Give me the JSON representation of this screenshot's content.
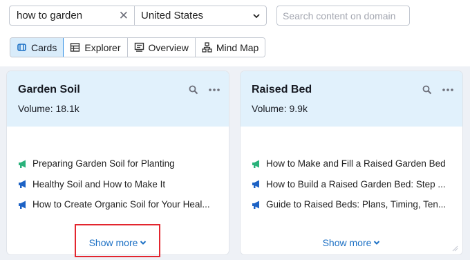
{
  "search": {
    "keyword": "how to garden",
    "clear_icon": "close-icon",
    "country": "United States",
    "domain_placeholder": "Search content on domain"
  },
  "tabs": [
    {
      "label": "Cards",
      "icon": "cards-icon",
      "active": true
    },
    {
      "label": "Explorer",
      "icon": "table-icon",
      "active": false
    },
    {
      "label": "Overview",
      "icon": "overview-icon",
      "active": false
    },
    {
      "label": "Mind Map",
      "icon": "mindmap-icon",
      "active": false
    }
  ],
  "cards": [
    {
      "title": "Garden Soil",
      "volume": "Volume:  18.1k",
      "items": [
        {
          "text": "Preparing Garden Soil for Planting",
          "color": "#2ab27b"
        },
        {
          "text": "Healthy Soil and How to Make It",
          "color": "#1d62c5"
        },
        {
          "text": "How to Create Organic Soil for Your Heal...",
          "color": "#1d62c5"
        }
      ],
      "show_more": "Show more"
    },
    {
      "title": "Raised Bed",
      "volume": "Volume:  9.9k",
      "items": [
        {
          "text": "How to Make and Fill a Raised Garden Bed",
          "color": "#2ab27b"
        },
        {
          "text": "How to Build a Raised Garden Bed: Step ...",
          "color": "#1d62c5"
        },
        {
          "text": "Guide to Raised Beds: Plans, Timing, Ten...",
          "color": "#1d62c5"
        }
      ],
      "show_more": "Show more"
    }
  ],
  "colors": {
    "accent": "#2b8ce4",
    "card_header": "#e1f1fc",
    "highlight": "#e3262f",
    "link": "#1a6fc4"
  }
}
